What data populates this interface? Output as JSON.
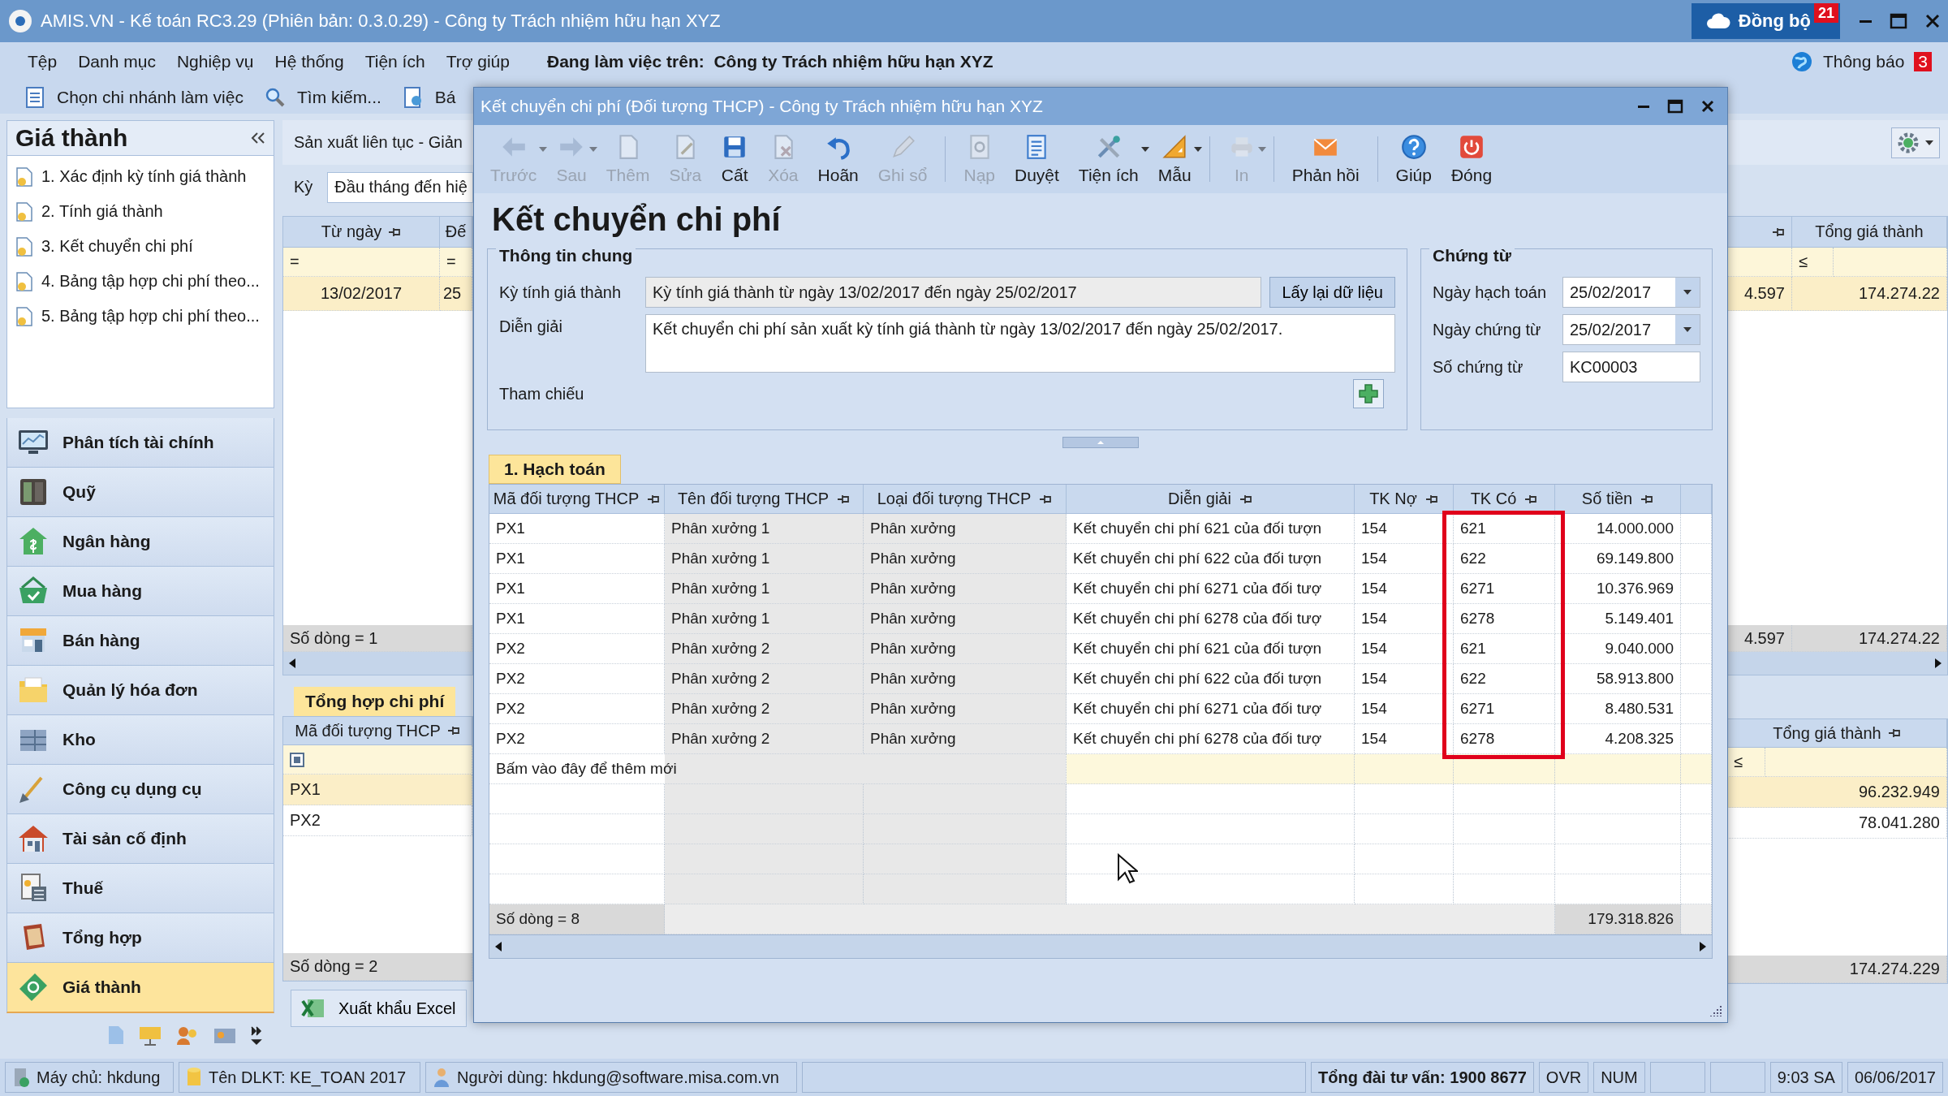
{
  "window": {
    "title": "AMIS.VN - Kế toán RC3.29 (Phiên bản: 0.3.0.29) - Công ty Trách nhiệm hữu hạn XYZ",
    "sync": {
      "label": "Đồng bộ",
      "badge": "21"
    }
  },
  "menu": [
    "Tệp",
    "Danh mục",
    "Nghiệp vụ",
    "Hệ thống",
    "Tiện ích",
    "Trợ giúp"
  ],
  "working_on": {
    "label": "Đang làm việc trên:",
    "company": "Công ty Trách nhiệm hữu hạn XYZ"
  },
  "notifications": {
    "label": "Thông báo",
    "badge": "3"
  },
  "quick_toolbar": [
    "Chọn chi nhánh làm việc",
    "Tìm kiếm...",
    "Bá"
  ],
  "sidebar": {
    "title": "Giá thành",
    "tasks": [
      "1. Xác định kỳ tính giá thành",
      "2. Tính giá thành",
      "3. Kết chuyển chi phí",
      "4. Bảng tập hợp chi phí theo...",
      "5. Bảng tập hợp chi phí theo..."
    ],
    "modules": [
      {
        "label": "Phân tích tài chính",
        "selected": false
      },
      {
        "label": "Quỹ",
        "selected": false
      },
      {
        "label": "Ngân hàng",
        "selected": false
      },
      {
        "label": "Mua hàng",
        "selected": false
      },
      {
        "label": "Bán hàng",
        "selected": false
      },
      {
        "label": "Quản lý hóa đơn",
        "selected": false
      },
      {
        "label": "Kho",
        "selected": false
      },
      {
        "label": "Công cụ dụng cụ",
        "selected": false
      },
      {
        "label": "Tài sản cố định",
        "selected": false
      },
      {
        "label": "Thuế",
        "selected": false
      },
      {
        "label": "Tổng hợp",
        "selected": false
      },
      {
        "label": "Giá thành",
        "selected": true
      }
    ]
  },
  "background": {
    "tab": "Sản xuất liên tục - Giản",
    "period": {
      "label": "Kỳ",
      "value": "Đầu tháng đến hiệ"
    },
    "period_grid": {
      "left_columns": [
        "Từ ngày",
        "Đế"
      ],
      "left_filters": [
        "=",
        "="
      ],
      "left_row": [
        "13/02/2017",
        "25"
      ],
      "left_footer": "Số dòng = 1",
      "right_column": "Tổng giá thành",
      "right_filter": "≤",
      "right_row": [
        "4.597",
        "174.274.22"
      ],
      "right_footer": [
        "4.597",
        "174.274.22"
      ]
    },
    "cost_summary": {
      "tab": "Tổng hợp chi phí",
      "left_column": "Mã đối tượng THCP",
      "rows": [
        {
          "code": "PX1",
          "total": "96.232.949",
          "selected": true
        },
        {
          "code": "PX2",
          "total": "78.041.280",
          "selected": false
        }
      ],
      "left_footer": "Số dòng = 2",
      "right_column": "Tổng giá thành",
      "right_filter": "≤",
      "right_footer": "174.274.229"
    },
    "export_button": "Xuất khẩu Excel"
  },
  "dialog": {
    "title": "Kết chuyển chi phí (Đối tượng THCP) - Công ty Trách nhiệm hữu hạn XYZ",
    "toolbar": [
      {
        "kind": "button",
        "label": "Trước",
        "disabled": true,
        "dropdown": true
      },
      {
        "kind": "button",
        "label": "Sau",
        "disabled": true,
        "dropdown": true
      },
      {
        "kind": "button",
        "label": "Thêm",
        "disabled": true,
        "dropdown": false
      },
      {
        "kind": "button",
        "label": "Sửa",
        "disabled": true,
        "dropdown": false
      },
      {
        "kind": "button",
        "label": "Cất",
        "disabled": false,
        "dropdown": false
      },
      {
        "kind": "button",
        "label": "Xóa",
        "disabled": true,
        "dropdown": false
      },
      {
        "kind": "button",
        "label": "Hoãn",
        "disabled": false,
        "dropdown": false
      },
      {
        "kind": "button",
        "label": "Ghi sổ",
        "disabled": true,
        "dropdown": false
      },
      {
        "kind": "separator"
      },
      {
        "kind": "button",
        "label": "Nạp",
        "disabled": true,
        "dropdown": false
      },
      {
        "kind": "button",
        "label": "Duyệt",
        "disabled": false,
        "dropdown": false
      },
      {
        "kind": "button",
        "label": "Tiện ích",
        "disabled": false,
        "dropdown": true
      },
      {
        "kind": "button",
        "label": "Mẫu",
        "disabled": false,
        "dropdown": true
      },
      {
        "kind": "separator"
      },
      {
        "kind": "button",
        "label": "In",
        "disabled": true,
        "dropdown": true
      },
      {
        "kind": "separator"
      },
      {
        "kind": "button",
        "label": "Phản hồi",
        "disabled": false,
        "dropdown": false
      },
      {
        "kind": "separator"
      },
      {
        "kind": "button",
        "label": "Giúp",
        "disabled": false,
        "dropdown": false
      },
      {
        "kind": "button",
        "label": "Đóng",
        "disabled": false,
        "dropdown": false
      }
    ],
    "heading": "Kết chuyển chi phí",
    "general": {
      "title": "Thông tin chung",
      "period_label": "Kỳ tính giá thành",
      "period_value": "Kỳ tính giá thành từ ngày 13/02/2017 đến ngày 25/02/2017",
      "reload_button": "Lấy lại dữ liệu",
      "description_label": "Diễn giải",
      "description_value": "Kết chuyển chi phí sản xuất kỳ tính giá thành từ ngày 13/02/2017 đến ngày 25/02/2017.",
      "reference_label": "Tham chiếu"
    },
    "voucher": {
      "title": "Chứng từ",
      "fields": [
        {
          "kind": "date",
          "label": "Ngày hạch toán",
          "value": "25/02/2017"
        },
        {
          "kind": "date",
          "label": "Ngày chứng từ",
          "value": "25/02/2017"
        },
        {
          "kind": "text",
          "label": "Số chứng từ",
          "value": "KC00003"
        }
      ]
    },
    "tab": "1. Hạch toán",
    "grid": {
      "columns": [
        {
          "label": "Mã đối tượng THCP",
          "highlighted": false
        },
        {
          "label": "Tên đối tượng THCP",
          "highlighted": false
        },
        {
          "label": "Loại đối tượng THCP",
          "highlighted": false
        },
        {
          "label": "Diễn giải",
          "highlighted": false
        },
        {
          "label": "TK Nợ",
          "highlighted": false
        },
        {
          "label": "TK Có",
          "highlighted": true
        },
        {
          "label": "Số tiền",
          "highlighted": false
        }
      ],
      "rows": [
        [
          "PX1",
          "Phân xưởng 1",
          "Phân xưởng",
          "Kết chuyển chi phí 621 của đối tượn",
          "154",
          "621",
          "14.000.000"
        ],
        [
          "PX1",
          "Phân xưởng 1",
          "Phân xưởng",
          "Kết chuyển chi phí 622 của đối tượn",
          "154",
          "622",
          "69.149.800"
        ],
        [
          "PX1",
          "Phân xưởng 1",
          "Phân xưởng",
          "Kết chuyển chi phí 6271 của đối tượ",
          "154",
          "6271",
          "10.376.969"
        ],
        [
          "PX1",
          "Phân xưởng 1",
          "Phân xưởng",
          "Kết chuyển chi phí 6278 của đối tượ",
          "154",
          "6278",
          "5.149.401"
        ],
        [
          "PX2",
          "Phân xưởng 2",
          "Phân xưởng",
          "Kết chuyển chi phí 621 của đối tượn",
          "154",
          "621",
          "9.040.000"
        ],
        [
          "PX2",
          "Phân xưởng 2",
          "Phân xưởng",
          "Kết chuyển chi phí 622 của đối tượn",
          "154",
          "622",
          "58.913.800"
        ],
        [
          "PX2",
          "Phân xưởng 2",
          "Phân xưởng",
          "Kết chuyển chi phí 6271 của đối tượ",
          "154",
          "6271",
          "8.480.531"
        ],
        [
          "PX2",
          "Phân xưởng 2",
          "Phân xưởng",
          "Kết chuyển chi phí 6278 của đối tượ",
          "154",
          "6278",
          "4.208.325"
        ]
      ],
      "add_row": "Bấm vào đây để thêm mới",
      "footer_count": "Số dòng = 8",
      "footer_total": "179.318.826"
    }
  },
  "status_bar": [
    {
      "kind": "server",
      "text": "Máy chủ: hkdung"
    },
    {
      "kind": "database",
      "text": "Tên DLKT: KE_TOAN 2017"
    },
    {
      "kind": "user",
      "text": "Người dùng: hkdung@software.misa.com.vn"
    },
    {
      "kind": "empty"
    },
    {
      "kind": "hotline",
      "text": "Tổng đài tư vấn: 1900 8677"
    },
    {
      "kind": "plain",
      "text": "OVR"
    },
    {
      "kind": "plain",
      "text": "NUM"
    },
    {
      "kind": "empty"
    },
    {
      "kind": "empty"
    },
    {
      "kind": "plain",
      "text": "9:03 SA"
    },
    {
      "kind": "plain",
      "text": "06/06/2017"
    }
  ]
}
